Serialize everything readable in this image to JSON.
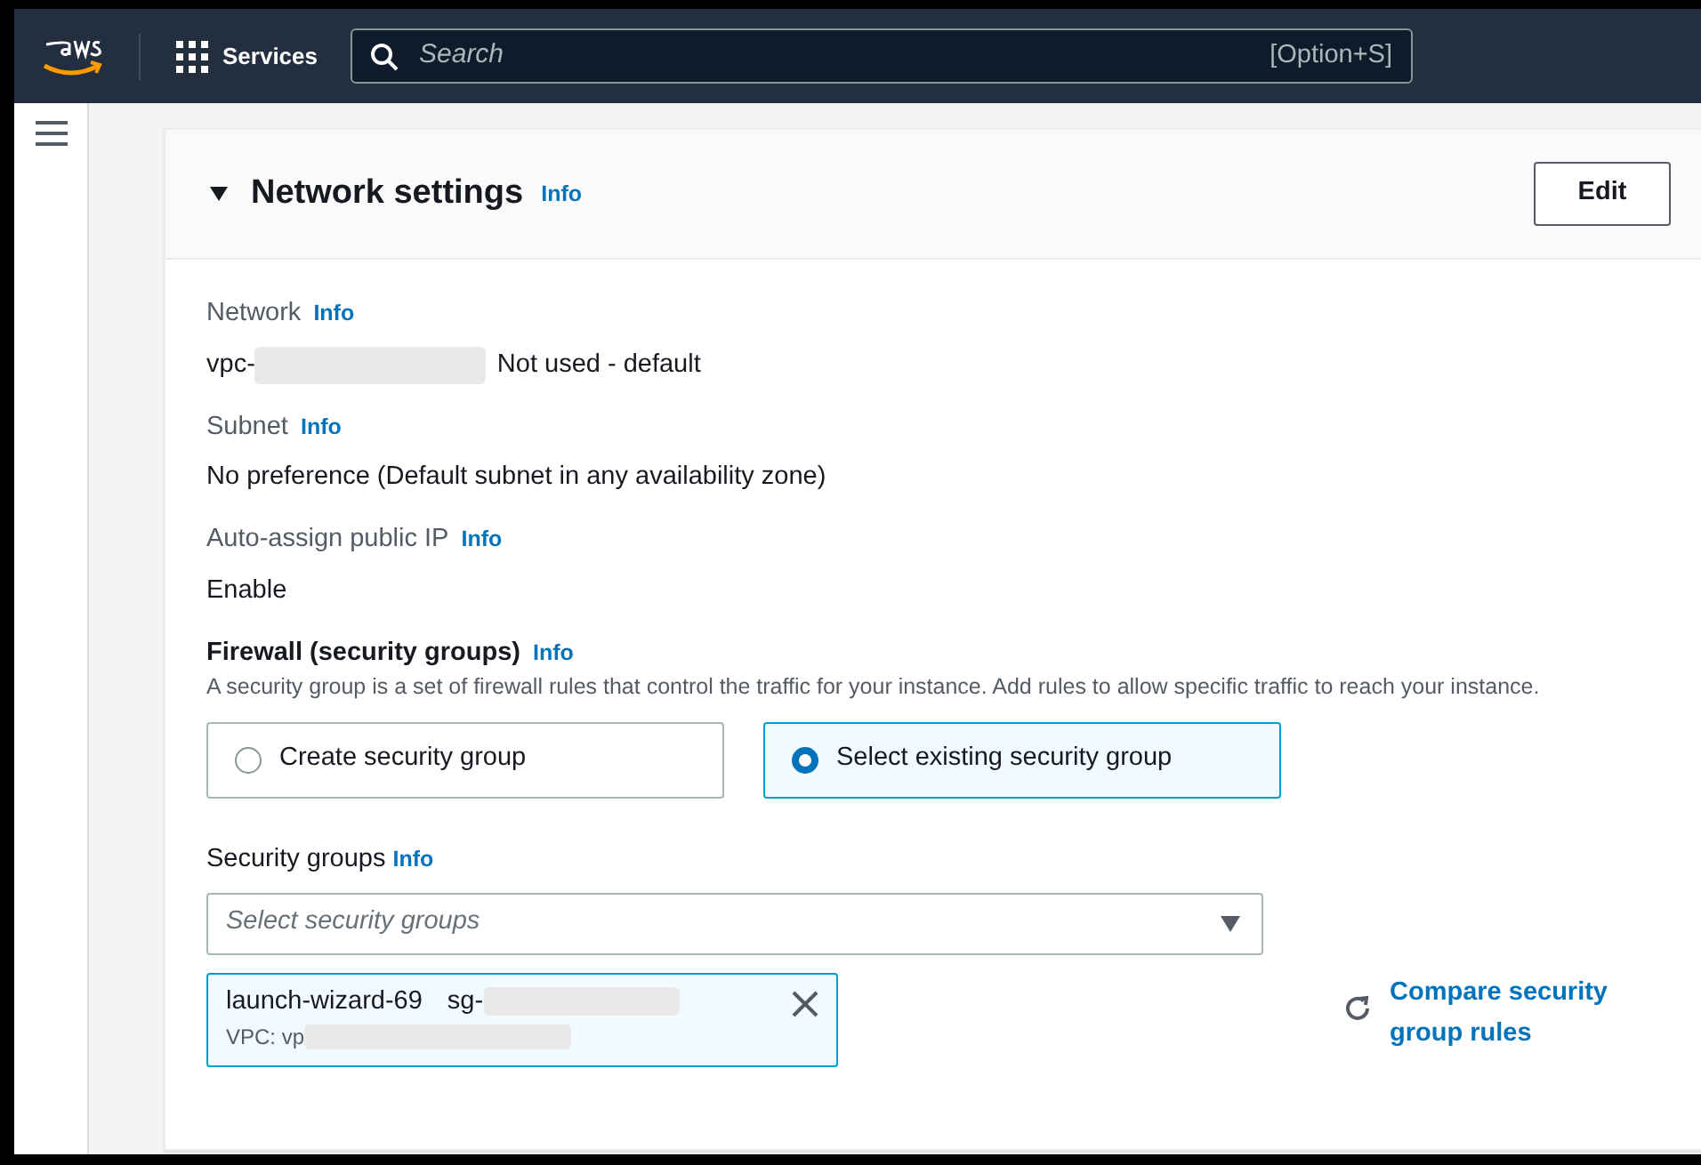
{
  "top_nav": {
    "services": "Services",
    "search": {
      "placeholder": "Search"
    },
    "shortcut": "[Option+S]"
  },
  "panel": {
    "title": "Network settings",
    "expanded": true,
    "info": "Info",
    "edit": "Edit"
  },
  "fields": [
    {
      "label": "Network",
      "info": "Info",
      "prefix": "vpc-",
      "redacted": true,
      "value": "Not used - default"
    },
    {
      "label": "Subnet",
      "info": "Info",
      "redacted": false,
      "value": "No preference (Default subnet in any availability zone)"
    },
    {
      "label": "Auto-assign public IP",
      "info": "Info",
      "redacted": false,
      "value": "Enable"
    }
  ],
  "firewall": {
    "label": "Firewall (security groups)",
    "info": "Info",
    "description": "A security group is a set of firewall rules that control the traffic for your instance. Add rules to allow specific traffic to reach your instance.",
    "options": [
      {
        "label": "Create security group",
        "selected": false
      },
      {
        "label": "Select existing security group",
        "selected": true
      }
    ]
  },
  "security_groups": {
    "label": "Security groups",
    "info": "Info",
    "placeholder": "Select security groups",
    "chips": [
      {
        "name": "launch-wizard-69",
        "id": "sg-",
        "vpc": "VPC: vp",
        "redacted": true
      }
    ],
    "compare": "Compare security group rules"
  }
}
